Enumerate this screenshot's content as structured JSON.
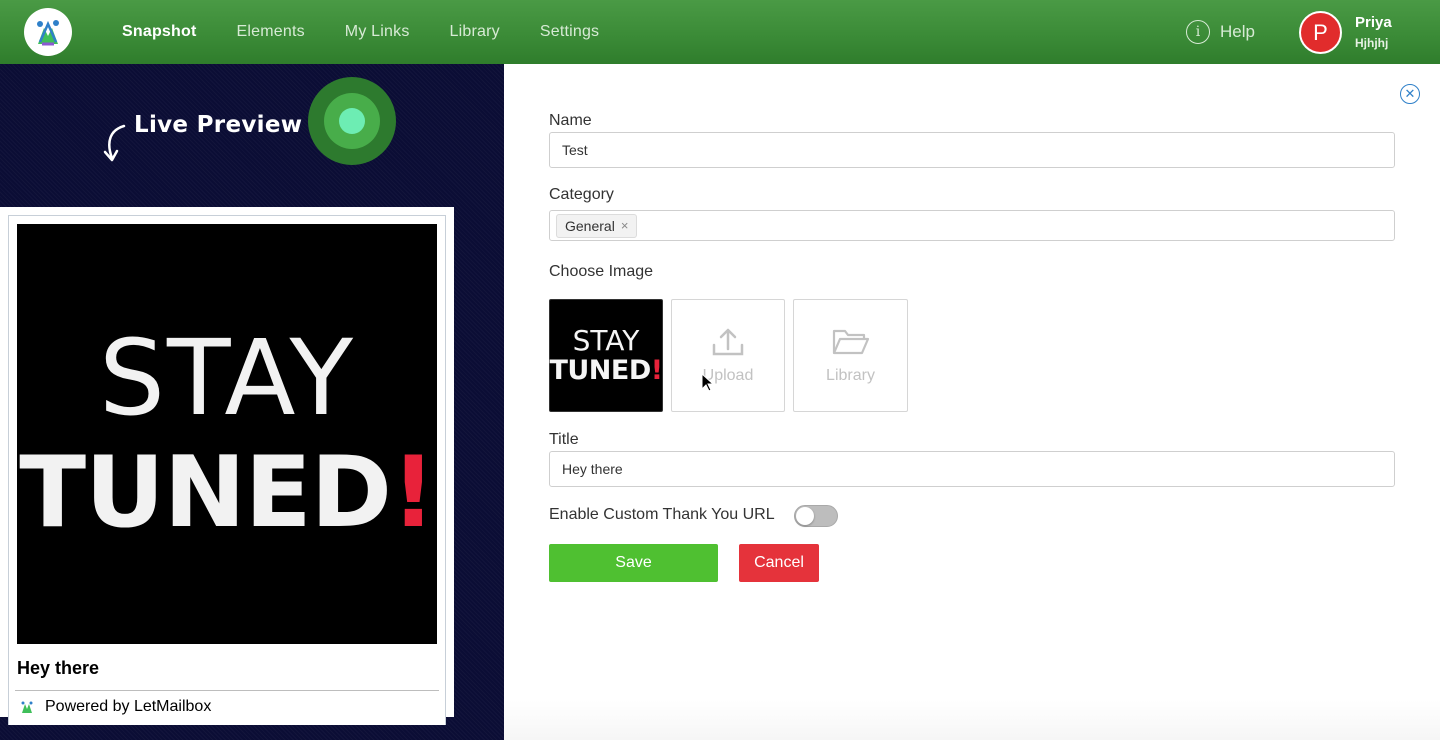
{
  "nav": {
    "items": [
      {
        "label": "Snapshot",
        "active": true
      },
      {
        "label": "Elements"
      },
      {
        "label": "My Links"
      },
      {
        "label": "Library"
      },
      {
        "label": "Settings"
      }
    ],
    "help_label": "Help",
    "user": {
      "initial": "P",
      "name": "Priya",
      "subtitle": "Hjhjhj"
    }
  },
  "preview": {
    "live_label": "Live Preview",
    "image_text_line1": "STAY",
    "image_text_line2": "TUNED",
    "image_text_bang": "!",
    "title": "Hey there",
    "powered_by": "Powered by LetMailbox"
  },
  "form": {
    "name_label": "Name",
    "name_value": "Test",
    "category_label": "Category",
    "category_tags": [
      "General"
    ],
    "choose_image_label": "Choose Image",
    "upload_label": "Upload",
    "library_label": "Library",
    "title_label": "Title",
    "title_value": "Hey there",
    "custom_url_label": "Enable Custom Thank You URL",
    "custom_url_enabled": false,
    "save_label": "Save",
    "cancel_label": "Cancel"
  },
  "colors": {
    "nav_green": "#3a8a36",
    "save_green": "#4fc031",
    "cancel_red": "#e5333b",
    "avatar_red": "#e12c2c",
    "preview_bg": "#0b0d35",
    "accent_blue": "#2f80c9"
  },
  "icons": [
    "app-logo-icon",
    "info-icon",
    "curved-arrow-icon",
    "pulse-indicator-icon",
    "close-circle-icon",
    "upload-icon",
    "folder-icon",
    "letmailbox-icon",
    "mouse-cursor-icon"
  ]
}
